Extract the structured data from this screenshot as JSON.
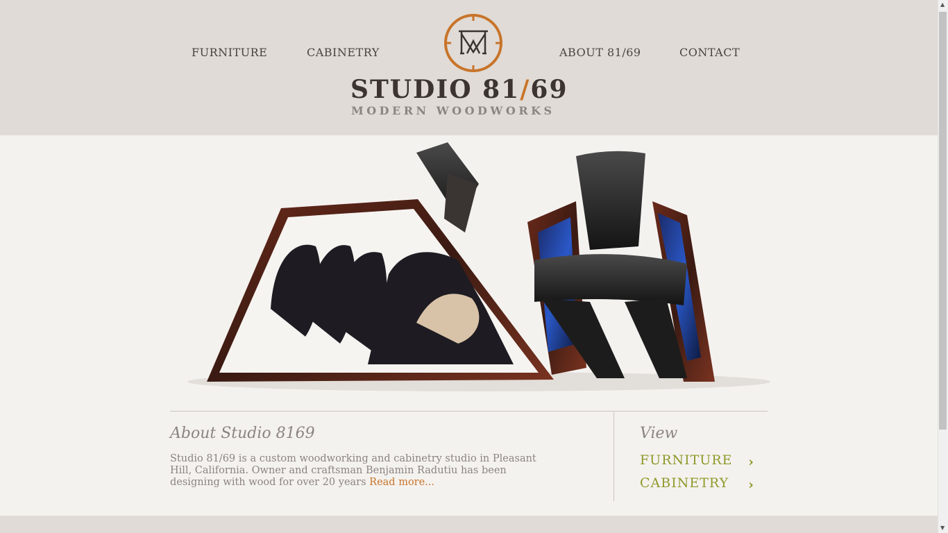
{
  "nav": {
    "furniture": "FURNITURE",
    "cabinetry": "CABINETRY",
    "about": "ABOUT 81/69",
    "contact": "CONTACT"
  },
  "logo": {
    "title_a": "STUDIO 81",
    "title_slash": "/",
    "title_b": "69",
    "subtitle": "MODERN WOODWORKS",
    "monogram_icon": "circle-monogram-icon"
  },
  "about": {
    "heading": "About Studio 8169",
    "text": "Studio 81/69 is a custom woodworking and cabinetry studio in Pleasant Hill, California. Owner and craftsman Benjamin Radutiu has been designing with wood for over 20 years ",
    "read_more": "Read more..."
  },
  "view": {
    "heading": "View",
    "links": [
      {
        "label": "FURNITURE",
        "icon": "chevron-right-icon"
      },
      {
        "label": "CABINETRY",
        "icon": "chevron-right-icon"
      }
    ]
  },
  "hero": {
    "image": "chairs-with-horses-photo"
  },
  "scrollbar": {
    "up": "▲",
    "down": "▼"
  },
  "colors": {
    "accent_orange": "#c8742a",
    "accent_green": "#8e9a2a",
    "text_dark": "#3b3431",
    "text_muted": "#8c8480",
    "header_bg": "#e0dbd6"
  }
}
